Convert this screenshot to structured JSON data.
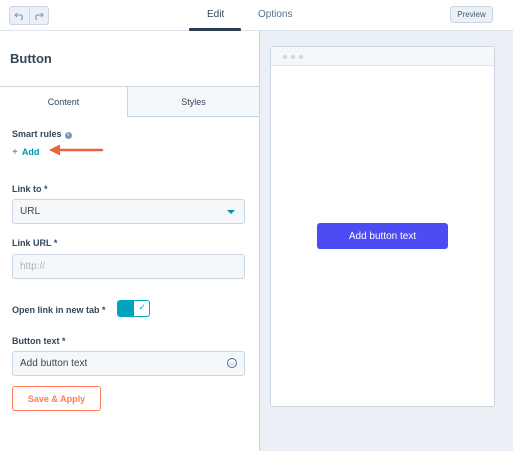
{
  "toolbar": {
    "undo_icon": "undo-icon",
    "redo_icon": "redo-icon",
    "tabs": [
      {
        "label": "Edit",
        "active": true
      },
      {
        "label": "Options",
        "active": false
      }
    ],
    "preview_label": "Preview"
  },
  "panel": {
    "title": "Button",
    "tabs": [
      {
        "label": "Content",
        "active": true
      },
      {
        "label": "Styles",
        "active": false
      }
    ],
    "smart_rules": {
      "label": "Smart rules",
      "info_icon": "info-icon",
      "add_label": "Add"
    },
    "link_to": {
      "label": "Link to *",
      "value": "URL"
    },
    "link_url": {
      "label": "Link URL *",
      "placeholder": "http://"
    },
    "new_tab": {
      "label": "Open link in new tab *",
      "checked": true
    },
    "button_text": {
      "label": "Button text *",
      "value": "Add button text",
      "emoji_icon": "emoji-icon"
    },
    "save_label": "Save & Apply"
  },
  "preview": {
    "button_label": "Add button text"
  },
  "colors": {
    "accent_teal": "#00a4bd",
    "link": "#0091ae",
    "cta_orange": "#ff7a59",
    "preview_button": "#4c4cf5",
    "annotation_arrow": "#e8663d"
  }
}
